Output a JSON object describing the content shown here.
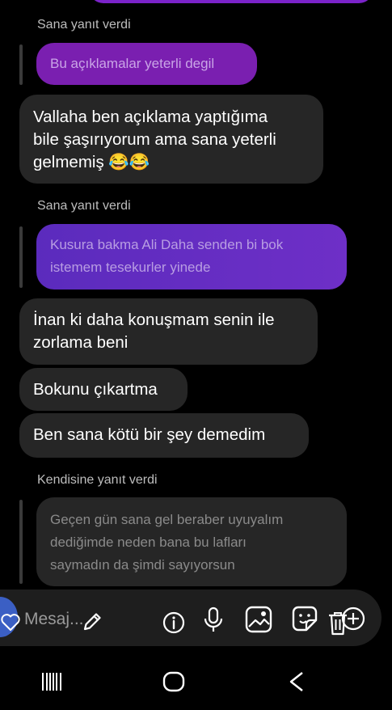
{
  "conversation": {
    "reply_groups": [
      {
        "header": "Sana yanıt verdi",
        "quoted_message": "Bu açıklamalar yeterli degil"
      },
      {
        "header": "Sana yanıt verdi",
        "quoted_message": "Kusura bakma Ali Daha senden bi bok\nistemem  tesekurler yinede"
      },
      {
        "header": "Kendisine yanıt verdi",
        "quoted_message": "Geçen gün sana gel beraber uyuyalım\ndediğimde neden bana bu lafları\nsaymadın da şimdi sayıyorsun"
      }
    ],
    "messages": [
      "Vallaha ben açıklama yaptığıma\nbile şaşırıyorum ama sana yeterli\ngelmemiş 😂😂",
      "İnan ki daha konuşmam senin ile\nzorlama beni",
      "Bokunu çıkartma",
      "Ben sana kötü bir şey demedim"
    ]
  },
  "composer": {
    "placeholder": "Mesaj..."
  },
  "colors": {
    "background": "#000000",
    "received_bubble": "#262626",
    "sent_purple": "#7a1fb0",
    "sent_violet": "#5b2bbd",
    "composer_bg": "#1e1e1e"
  },
  "icons": {
    "composer": [
      "heart-icon",
      "pencil-icon",
      "info-icon",
      "microphone-icon",
      "gallery-icon",
      "sticker-icon",
      "trash-icon",
      "plus-circle-icon"
    ],
    "navbar": [
      "recent-apps-icon",
      "home-icon",
      "back-icon"
    ]
  }
}
